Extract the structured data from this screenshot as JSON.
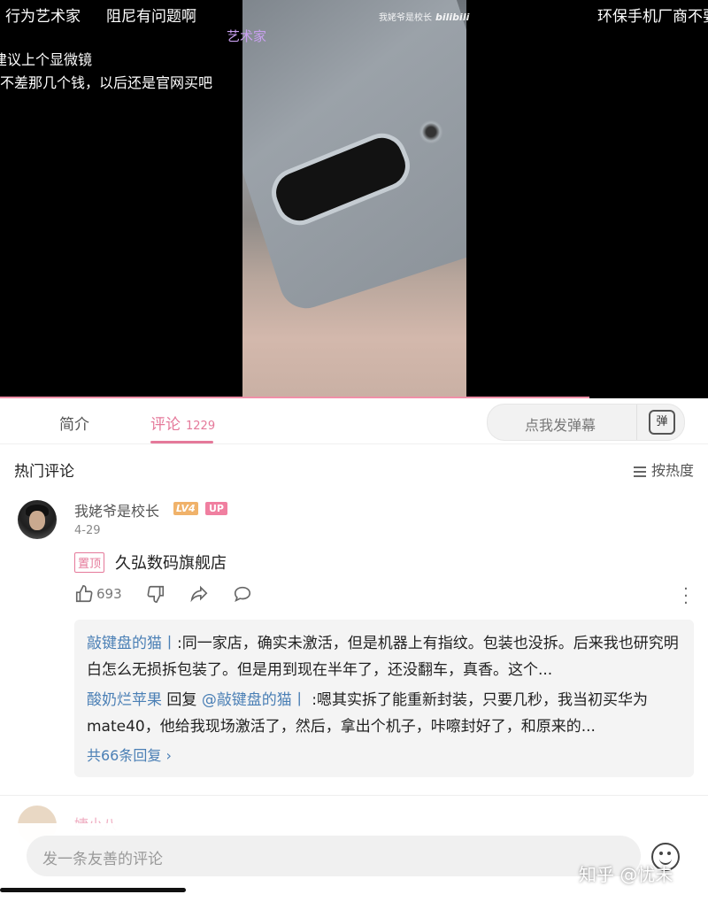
{
  "video": {
    "watermark_text": "我姥爷是校长",
    "watermark_logo": "bilibili",
    "danmaku": [
      "行为艺术家",
      "阻尼有问题啊",
      "艺术家",
      "环保手机厂商不要",
      "建议上个显微镜",
      "不差那几个钱，以后还是官网买吧"
    ]
  },
  "tabs": {
    "intro": "简介",
    "comments": "评论",
    "comments_count": "1229"
  },
  "danmaku_input": {
    "placeholder": "点我发弹幕",
    "icon_text": "弹"
  },
  "section": {
    "title": "热门评论",
    "sort_label": "按热度"
  },
  "comment": {
    "username": "我姥爷是校长",
    "level": "LV4",
    "up_badge": "UP",
    "date": "4-29",
    "pinned_tag": "置顶",
    "text": "久弘数码旗舰店",
    "likes": "693",
    "replies": [
      {
        "author": "敲键盘的猫丨",
        "text": ":同一家店，确实未激活，但是机器上有指纹。包装也没拆。后来我也研究明白怎么无损拆包装了。但是用到现在半年了，还没翻车，真香。这个..."
      },
      {
        "author": "酸奶烂苹果",
        "reply_word": "回复",
        "mention": "@敲键盘的猫丨",
        "text": ":嗯其实拆了能重新封装，只要几秒，我当初买华为mate40，他给我现场激活了，然后，拿出个机子，咔嚓封好了，和原来的..."
      }
    ],
    "view_more": "共66条回复"
  },
  "next_comment": {
    "username": "婕小八"
  },
  "composer": {
    "placeholder": "发一条友善的评论"
  },
  "overlay_watermark": "知乎 @忧未",
  "colors": {
    "accent": "#e5799a",
    "link": "#4a7fb5"
  }
}
